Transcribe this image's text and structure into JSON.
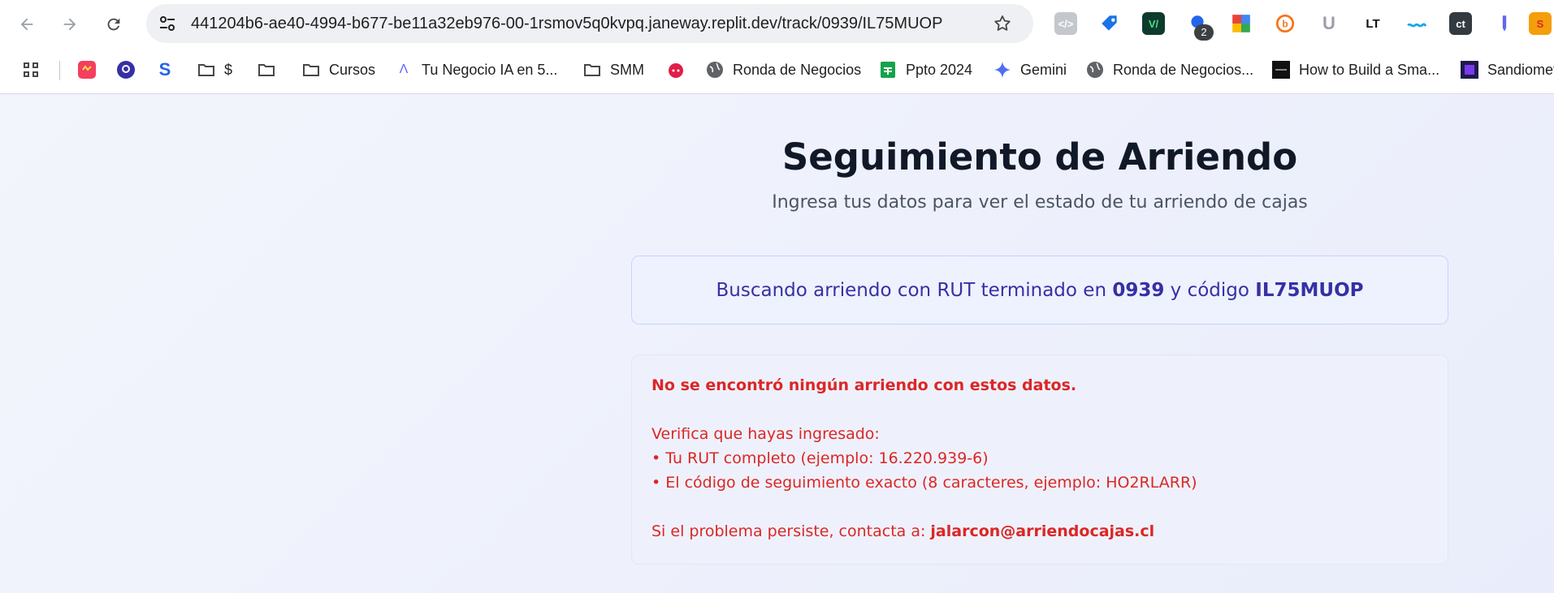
{
  "browser": {
    "url": "441204b6-ae40-4994-b677-be11a32eb976-00-1rsmov5q0kvpq.janeway.replit.dev/track/0939/IL75MUOP",
    "extension_badge": "2",
    "extensions": [
      "ct",
      "LT"
    ],
    "bookmarks": [
      {
        "label": "",
        "icon": "apps-icon"
      },
      {
        "label": "",
        "icon": "bookmark-app-icon"
      },
      {
        "label": "",
        "icon": "location-pin-icon"
      },
      {
        "label": "",
        "icon": "s-letter-icon"
      },
      {
        "label": "$",
        "icon": "folder-icon"
      },
      {
        "label": "",
        "icon": "folder-icon"
      },
      {
        "label": "Cursos",
        "icon": "folder-icon"
      },
      {
        "label": "Tu Negocio IA en 5...",
        "icon": "caret-icon"
      },
      {
        "label": "SMM",
        "icon": "folder-icon"
      },
      {
        "label": "",
        "icon": "reddit-icon"
      },
      {
        "label": "Ronda de Negocios",
        "icon": "globe-icon"
      },
      {
        "label": "Ppto 2024",
        "icon": "sheets-icon"
      },
      {
        "label": "Gemini",
        "icon": "gemini-icon"
      },
      {
        "label": "Ronda de Negocios...",
        "icon": "globe-icon"
      },
      {
        "label": "How to Build a Sma...",
        "icon": "page-icon"
      },
      {
        "label": "Sandiomet",
        "icon": "page-icon"
      }
    ]
  },
  "page": {
    "title": "Seguimiento de Arriendo",
    "subtitle": "Ingresa tus datos para ver el estado de tu arriendo de cajas",
    "search": {
      "prefix": "Buscando arriendo con RUT terminado en",
      "rut": "0939",
      "middle": "y código",
      "code": "IL75MUOP"
    },
    "error": {
      "title": "No se encontró ningún arriendo con estos datos.",
      "verify_intro": "Verifica que hayas ingresado:",
      "item1": "• Tu RUT completo (ejemplo: 16.220.939-6)",
      "item2": "• El código de seguimiento exacto (8 caracteres, ejemplo: HO2RLARR)",
      "contact_prefix": "Si el problema persiste, contacta a:",
      "contact_email": "jalarcon@arriendocajas.cl"
    }
  },
  "colors": {
    "accent": "#3730a3",
    "error": "#dc2626",
    "background": "#eef1fb"
  }
}
